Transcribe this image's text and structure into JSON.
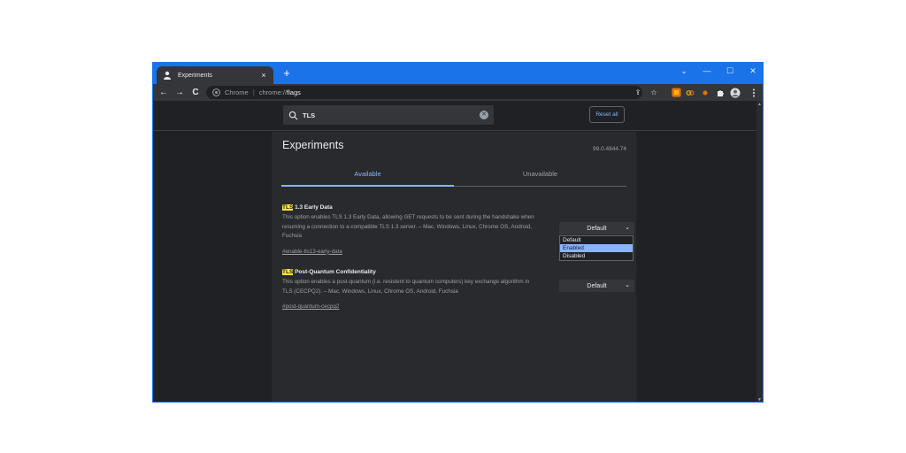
{
  "browser": {
    "tab_title": "Experiments",
    "tab_close": "×",
    "new_tab": "+",
    "window_controls": {
      "dropdown": "⌄",
      "minimize": "—",
      "maximize": "☐",
      "close": "✕"
    },
    "nav": {
      "back": "←",
      "forward": "→",
      "reload": "C"
    },
    "omnibox": {
      "site_label": "Chrome",
      "separator": "|",
      "scheme": "chrome://",
      "path": "flags"
    },
    "actions": {
      "share": "⇪",
      "bookmark": "☆"
    },
    "extensions": [
      "extension-orange-icon",
      "extension-link-icon",
      "extension-dot-icon",
      "puzzle-icon",
      "profile-avatar",
      "menu-icon"
    ],
    "colors": {
      "accent": "#1a73e8",
      "link": "#8ab4f8",
      "highlight": "#ffeb3b"
    }
  },
  "search": {
    "value": "TLS",
    "clear": "✕"
  },
  "reset_all": "Reset all",
  "page": {
    "title": "Experiments",
    "version": "99.0.4844.74",
    "tabs": [
      {
        "label": "Available",
        "active": true
      },
      {
        "label": "Unavailable",
        "active": false
      }
    ]
  },
  "experiments": [
    {
      "highlight": "TLS",
      "name_rest": " 1.3 Early Data",
      "description": "This option enables TLS 1.3 Early Data, allowing GET requests to be sent during the handshake when resuming a connection to a compatible TLS 1.3 server. – Mac, Windows, Linux, Chrome OS, Android, Fuchsia",
      "link": "#enable-tls13-early-data",
      "selected": "Default",
      "dropdown_open": true,
      "options": [
        "Default",
        "Enabled",
        "Disabled"
      ],
      "highlighted_option": "Enabled"
    },
    {
      "highlight": "TLS",
      "name_rest": " Post-Quantum Confidentiality",
      "description": "This option enables a post-quantum (i.e. resistent to quantum computers) key exchange algorithm in TLS (CECPQ2). – Mac, Windows, Linux, Chrome OS, Android, Fuchsia",
      "link": "#post-quantum-cecpq2",
      "selected": "Default",
      "dropdown_open": false
    }
  ]
}
